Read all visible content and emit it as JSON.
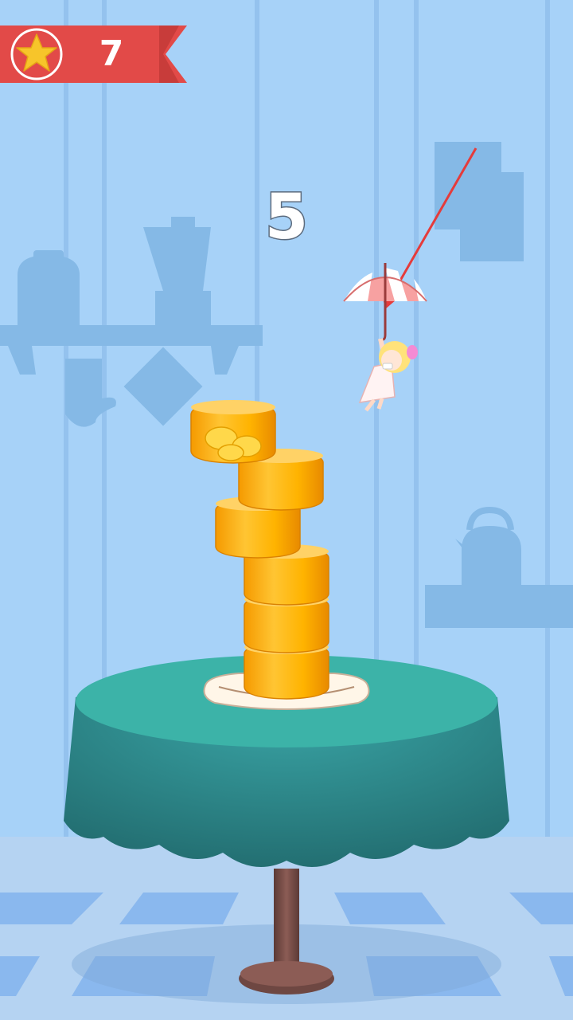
{
  "hud": {
    "stars_count": "7",
    "star_icon": "star-icon",
    "score": "5"
  },
  "colors": {
    "wall": "#a7d2f8",
    "wall_stripe": "#94c2ee",
    "silhouette": "#85b9e6",
    "banner": "#e24a48",
    "star": "#f7c52a",
    "jelly": "#ffb91a",
    "tablecloth": "#2f8d8f",
    "floor_light": "#b5d3f2",
    "floor_dark": "#8ab8ee"
  },
  "game": {
    "jelly_layers_on_table": 6,
    "falling_jelly": "jelly-with-banana-slices",
    "character": "girl-with-umbrella",
    "aim_indicator": "red-arrow"
  }
}
